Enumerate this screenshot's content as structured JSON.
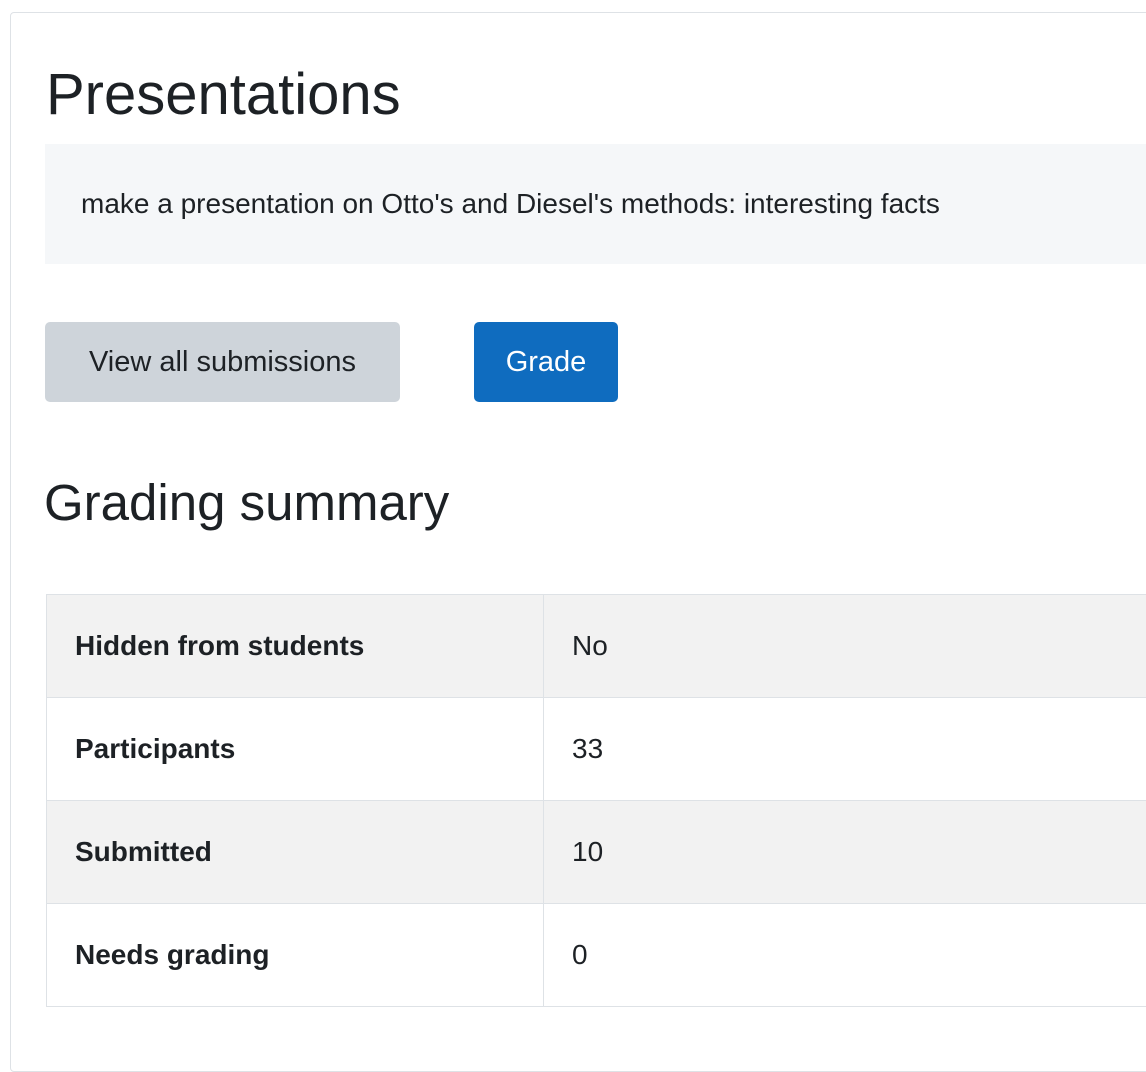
{
  "page": {
    "title": "Presentations",
    "description": "make a presentation on Otto's and Diesel's methods: interesting facts"
  },
  "actions": {
    "view_all_label": "View all submissions",
    "grade_label": "Grade"
  },
  "grading_summary": {
    "title": "Grading summary",
    "rows": [
      {
        "label": "Hidden from students",
        "value": "No"
      },
      {
        "label": "Participants",
        "value": "33"
      },
      {
        "label": "Submitted",
        "value": "10"
      },
      {
        "label": "Needs grading",
        "value": "0"
      }
    ]
  }
}
